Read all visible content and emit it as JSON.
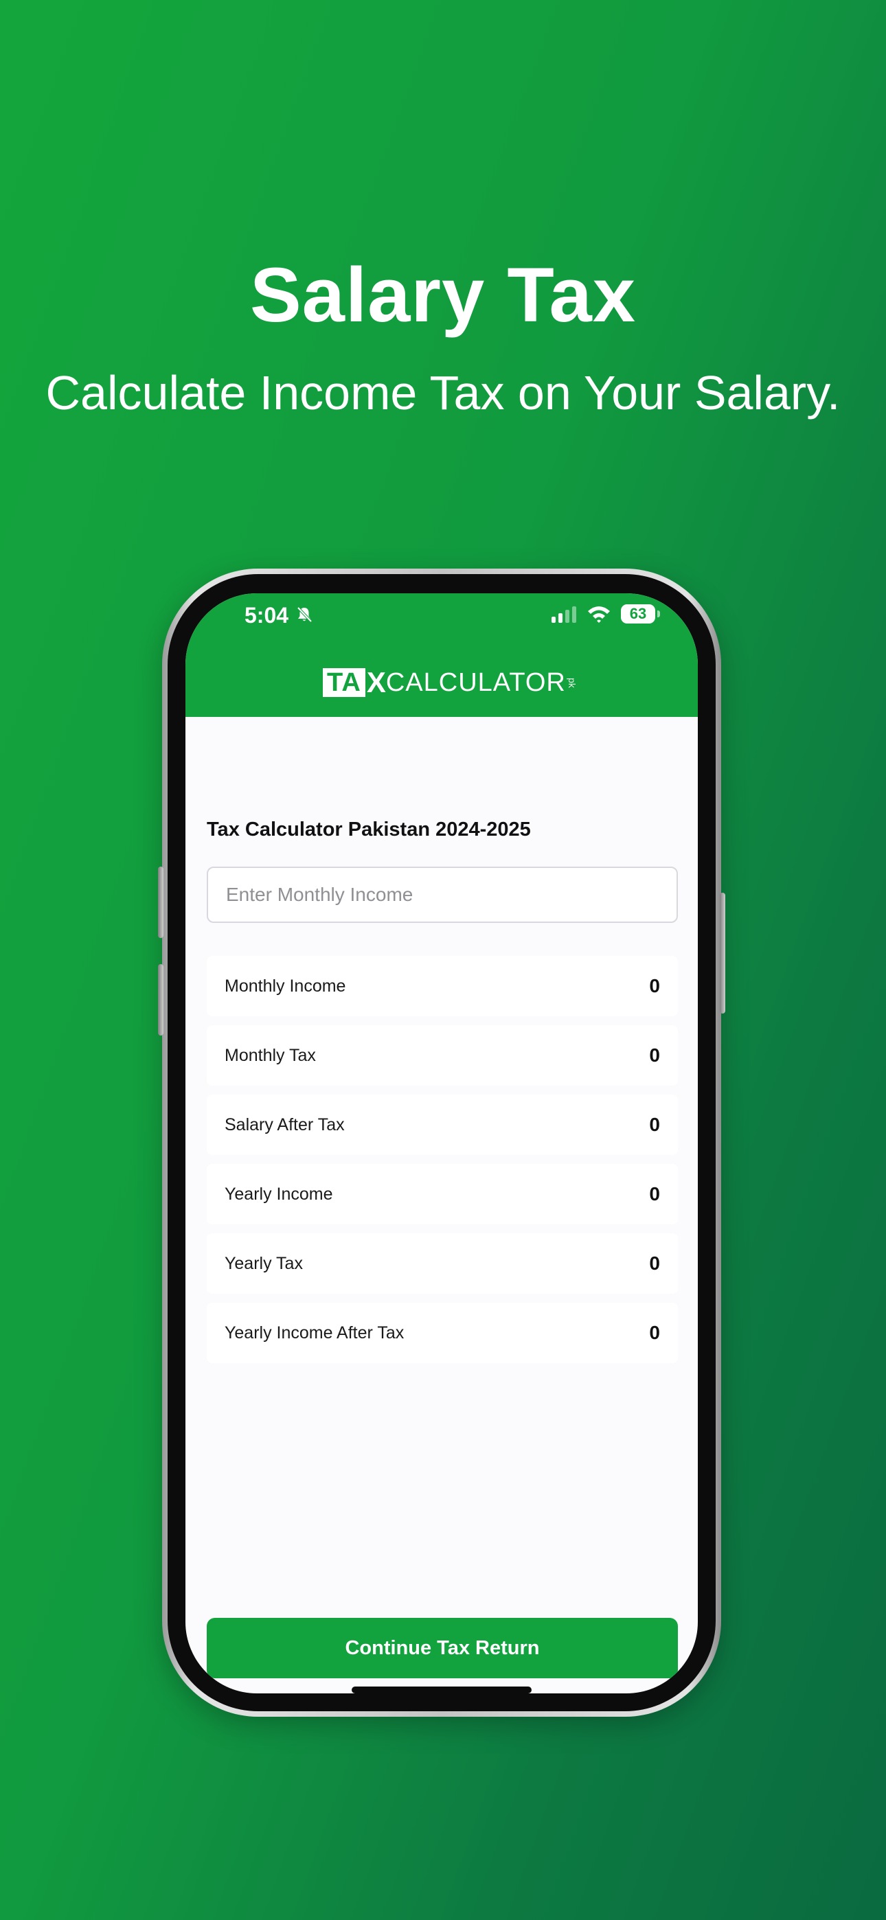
{
  "promo": {
    "headline": "Salary Tax",
    "subheadline": "Calculate Income Tax on Your Salary."
  },
  "status_bar": {
    "time": "5:04",
    "battery": "63",
    "icons": [
      "bell-slash-icon",
      "cellular-signal-icon",
      "wifi-icon",
      "battery-icon"
    ]
  },
  "header": {
    "logo_tax": "TA",
    "logo_x": "X",
    "logo_calculator": "CALCULATOR",
    "logo_suffix": "pk",
    "color": "#12a23e"
  },
  "main": {
    "title": "Tax Calculator Pakistan 2024-2025",
    "income_input": {
      "placeholder": "Enter Monthly Income",
      "value": ""
    },
    "results": [
      {
        "label": "Monthly Income",
        "value": "0"
      },
      {
        "label": "Monthly Tax",
        "value": "0"
      },
      {
        "label": "Salary After Tax",
        "value": "0"
      },
      {
        "label": "Yearly Income",
        "value": "0"
      },
      {
        "label": "Yearly Tax",
        "value": "0"
      },
      {
        "label": "Yearly Income After Tax",
        "value": "0"
      }
    ]
  },
  "footer": {
    "continue_label": "Continue Tax Return"
  },
  "colors": {
    "brand_green": "#12a23e",
    "background_gradient_start": "#14a63c",
    "background_gradient_end": "#0a6a40"
  }
}
